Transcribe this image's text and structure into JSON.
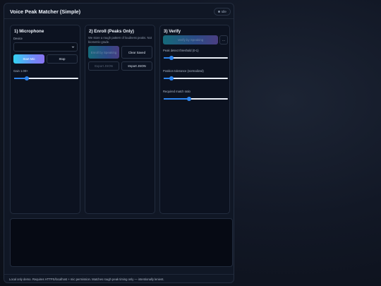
{
  "app": {
    "title": "Voice Peak Matcher (Simple)",
    "status": "Idle"
  },
  "microphone": {
    "title": "1) Microphone",
    "device_label": "Device",
    "device_value": "",
    "start_label": "Start Mic",
    "stop_label": "Stop",
    "gain_label": "Gain 1.00×",
    "gain_value": 0.2
  },
  "enroll": {
    "title": "2) Enroll (Peaks Only)",
    "description": "We store a rough pattern of loudness peaks. Not biometric-grade.",
    "enroll_label": "Enroll by Speaking",
    "clear_label": "Clear Saved",
    "export_label": "Export JSON",
    "import_label": "Import JSON"
  },
  "verify": {
    "title": "3) Verify",
    "verify_label": "Verify by Speaking",
    "more_label": "…",
    "threshold_label": "Peak detect threshold (0-1)",
    "threshold_value": 0.12,
    "tolerance_label": "Position tolerance (normalized)",
    "tolerance_value": 0.12,
    "ratio_label": "Required match ratio",
    "ratio_value": 0.4
  },
  "footer": {
    "text": "Local only demo. Requires HTTPS/localhost + mic permission. Matches rough peak timing only — intentionally lenient."
  },
  "colors": {
    "accent": "#2e86f0",
    "gradient_start": "#33d3f2",
    "gradient_end": "#8a72f2"
  }
}
